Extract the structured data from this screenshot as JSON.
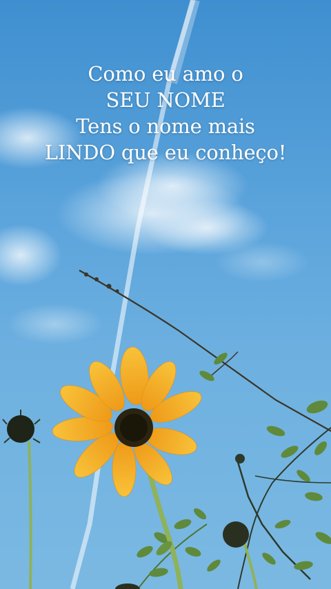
{
  "caption": {
    "line1": "Como eu amo o",
    "line2": "SEU NOME",
    "line3": "Tens o nome mais",
    "line4": "LINDO que eu conheço!"
  },
  "colors": {
    "sky_top": "#3f8fd0",
    "sky_bottom": "#7bb9e2",
    "petal": "#f4a820",
    "flower_center": "#2a2410",
    "stem": "#7ea84a",
    "text": "#ffffff"
  }
}
